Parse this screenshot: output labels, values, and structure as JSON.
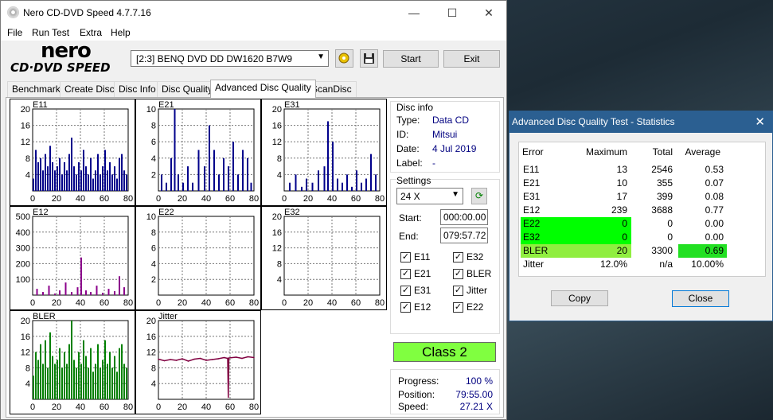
{
  "window": {
    "title": "Nero CD-DVD Speed 4.7.7.16",
    "minimize_glyph": "—",
    "maximize_glyph": "☐",
    "close_glyph": "✕"
  },
  "menu": [
    "File",
    "Run Test",
    "Extra",
    "Help"
  ],
  "logo": {
    "top": "nero",
    "bottom": "CD·DVD SPEED"
  },
  "toolbar": {
    "drive": "[2:3]   BENQ DVD DD DW1620 B7W9",
    "start_label": "Start",
    "exit_label": "Exit"
  },
  "tabs": [
    "Benchmark",
    "Create Disc",
    "Disc Info",
    "Disc Quality",
    "Advanced Disc Quality",
    "ScanDisc"
  ],
  "active_tab": "Advanced Disc Quality",
  "disc_info": {
    "title": "Disc info",
    "type_label": "Type:",
    "type": "Data CD",
    "id_label": "ID:",
    "id": "Mitsui",
    "date_label": "Date:",
    "date": "4 Jul 2019",
    "label_label": "Label:",
    "label": "-"
  },
  "settings": {
    "title": "Settings",
    "speed": "24 X",
    "start_label": "Start:",
    "start": "000:00.00",
    "end_label": "End:",
    "end": "079:57.72",
    "checks": [
      "E11",
      "E32",
      "E21",
      "BLER",
      "E31",
      "Jitter",
      "E12",
      "E22"
    ]
  },
  "class_label": "Class 2",
  "progress": {
    "progress_label": "Progress:",
    "progress": "100 %",
    "position_label": "Position:",
    "position": "79:55.00",
    "speed_label": "Speed:",
    "speed": "27.21 X"
  },
  "chart_data": [
    {
      "type": "bar",
      "title": "E11",
      "color": "#00008b",
      "ylim": [
        0,
        20
      ],
      "yticks": [
        4,
        8,
        12,
        16,
        20
      ],
      "xticks": [
        0,
        20,
        40,
        60,
        80
      ],
      "x": [
        0,
        2,
        4,
        6,
        8,
        10,
        12,
        14,
        16,
        18,
        20,
        22,
        24,
        26,
        28,
        30,
        32,
        34,
        36,
        38,
        40,
        42,
        44,
        46,
        48,
        50,
        52,
        54,
        56,
        58,
        60,
        62,
        64,
        66,
        68,
        70,
        72,
        74,
        76,
        78
      ],
      "values": [
        3,
        10,
        7,
        8,
        5,
        9,
        6,
        11,
        7,
        5,
        6,
        8,
        4,
        7,
        5,
        9,
        13,
        6,
        4,
        7,
        5,
        10,
        6,
        4,
        8,
        3,
        5,
        9,
        4,
        6,
        10,
        5,
        7,
        4,
        6,
        3,
        8,
        9,
        5,
        4
      ]
    },
    {
      "type": "bar",
      "title": "E21",
      "color": "#00008b",
      "ylim": [
        0,
        10
      ],
      "yticks": [
        2,
        4,
        6,
        8,
        10
      ],
      "xticks": [
        0,
        20,
        40,
        60,
        80
      ],
      "x": [
        2,
        6,
        10,
        13,
        16,
        20,
        24,
        28,
        33,
        38,
        42,
        46,
        50,
        54,
        58,
        62,
        66,
        70,
        74,
        77
      ],
      "values": [
        2,
        1,
        4,
        10,
        2,
        1,
        3,
        1,
        5,
        3,
        8,
        5,
        2,
        4,
        3,
        6,
        2,
        5,
        4,
        1
      ]
    },
    {
      "type": "bar",
      "title": "E31",
      "color": "#00008b",
      "ylim": [
        0,
        20
      ],
      "yticks": [
        4,
        8,
        12,
        16,
        20
      ],
      "xticks": [
        0,
        20,
        40,
        60,
        80
      ],
      "x": [
        4,
        9,
        14,
        18,
        23,
        28,
        33,
        36,
        40,
        44,
        48,
        52,
        56,
        60,
        64,
        68,
        72,
        76
      ],
      "values": [
        2,
        4,
        1,
        3,
        2,
        5,
        6,
        17,
        12,
        3,
        2,
        4,
        1,
        5,
        2,
        3,
        9,
        4
      ]
    },
    {
      "type": "bar",
      "title": "E12",
      "color": "#8b008b",
      "ylim": [
        0,
        500
      ],
      "yticks": [
        100,
        200,
        300,
        400,
        500
      ],
      "xticks": [
        0,
        20,
        40,
        60,
        80
      ],
      "x": [
        3,
        8,
        13,
        18,
        22,
        27,
        32,
        37,
        40,
        44,
        48,
        53,
        58,
        63,
        68,
        72,
        76
      ],
      "values": [
        40,
        20,
        60,
        10,
        30,
        80,
        20,
        50,
        239,
        30,
        20,
        60,
        15,
        40,
        25,
        120,
        50
      ]
    },
    {
      "type": "bar",
      "title": "E22",
      "color": "#00008b",
      "ylim": [
        0,
        10
      ],
      "yticks": [
        2,
        4,
        6,
        8,
        10
      ],
      "xticks": [
        0,
        20,
        40,
        60,
        80
      ],
      "x": [],
      "values": []
    },
    {
      "type": "bar",
      "title": "E32",
      "color": "#00008b",
      "ylim": [
        0,
        20
      ],
      "yticks": [
        4,
        8,
        12,
        16,
        20
      ],
      "xticks": [
        0,
        20,
        40,
        60,
        80
      ],
      "x": [],
      "values": []
    },
    {
      "type": "bar",
      "title": "BLER",
      "color": "#008000",
      "ylim": [
        0,
        20
      ],
      "yticks": [
        4,
        8,
        12,
        16,
        20
      ],
      "xticks": [
        0,
        20,
        40,
        60,
        80
      ],
      "x": [
        0,
        2,
        4,
        6,
        8,
        10,
        12,
        14,
        16,
        18,
        20,
        22,
        24,
        26,
        28,
        30,
        32,
        34,
        36,
        38,
        40,
        42,
        44,
        46,
        48,
        50,
        52,
        54,
        56,
        58,
        60,
        62,
        64,
        66,
        68,
        70,
        72,
        74,
        76,
        78
      ],
      "values": [
        6,
        12,
        10,
        14,
        9,
        15,
        8,
        17,
        11,
        9,
        10,
        13,
        8,
        12,
        9,
        14,
        20,
        10,
        8,
        12,
        9,
        15,
        11,
        8,
        13,
        7,
        9,
        14,
        8,
        10,
        15,
        9,
        12,
        8,
        11,
        7,
        13,
        14,
        9,
        8
      ]
    },
    {
      "type": "line",
      "title": "Jitter",
      "color": "#800040",
      "ylim": [
        0,
        20
      ],
      "yticks": [
        4,
        8,
        12,
        16,
        20
      ],
      "xticks": [
        0,
        20,
        40,
        60,
        80
      ],
      "x": [
        0,
        5,
        10,
        15,
        20,
        25,
        30,
        35,
        40,
        45,
        50,
        55,
        58,
        58.5,
        59,
        65,
        70,
        75,
        80
      ],
      "values": [
        10.2,
        9.8,
        10.1,
        9.9,
        10.3,
        9.7,
        10.2,
        10.4,
        9.9,
        10.1,
        10.3,
        10.6,
        10.4,
        0.5,
        10.5,
        10.7,
        10.4,
        10.8,
        10.6
      ]
    }
  ],
  "stats": {
    "title": "Advanced Disc Quality Test - Statistics",
    "headers": [
      "Error",
      "Maximum",
      "Total",
      "Average"
    ],
    "rows": [
      {
        "name": "E11",
        "max": "13",
        "total": "2546",
        "avg": "0.53",
        "max_bg": "",
        "avg_bg": ""
      },
      {
        "name": "E21",
        "max": "10",
        "total": "355",
        "avg": "0.07",
        "max_bg": "",
        "avg_bg": ""
      },
      {
        "name": "E31",
        "max": "17",
        "total": "399",
        "avg": "0.08",
        "max_bg": "",
        "avg_bg": ""
      },
      {
        "name": "E12",
        "max": "239",
        "total": "3688",
        "avg": "0.77",
        "max_bg": "",
        "avg_bg": ""
      },
      {
        "name": "E22",
        "max": "0",
        "total": "0",
        "avg": "0.00",
        "max_bg": "#00ff00",
        "avg_bg": ""
      },
      {
        "name": "E32",
        "max": "0",
        "total": "0",
        "avg": "0.00",
        "max_bg": "#00ff00",
        "avg_bg": ""
      },
      {
        "name": "BLER",
        "max": "20",
        "total": "3300",
        "avg": "0.69",
        "max_bg": "#90ee40",
        "avg_bg": "#22e022"
      },
      {
        "name": "Jitter",
        "max": "12.0%",
        "total": "n/a",
        "avg": "10.00%",
        "max_bg": "",
        "avg_bg": ""
      }
    ],
    "copy_label": "Copy",
    "close_label": "Close"
  },
  "colors": {
    "class_bg": "#80ff40",
    "titlebar_blue": "#2b5f91"
  }
}
